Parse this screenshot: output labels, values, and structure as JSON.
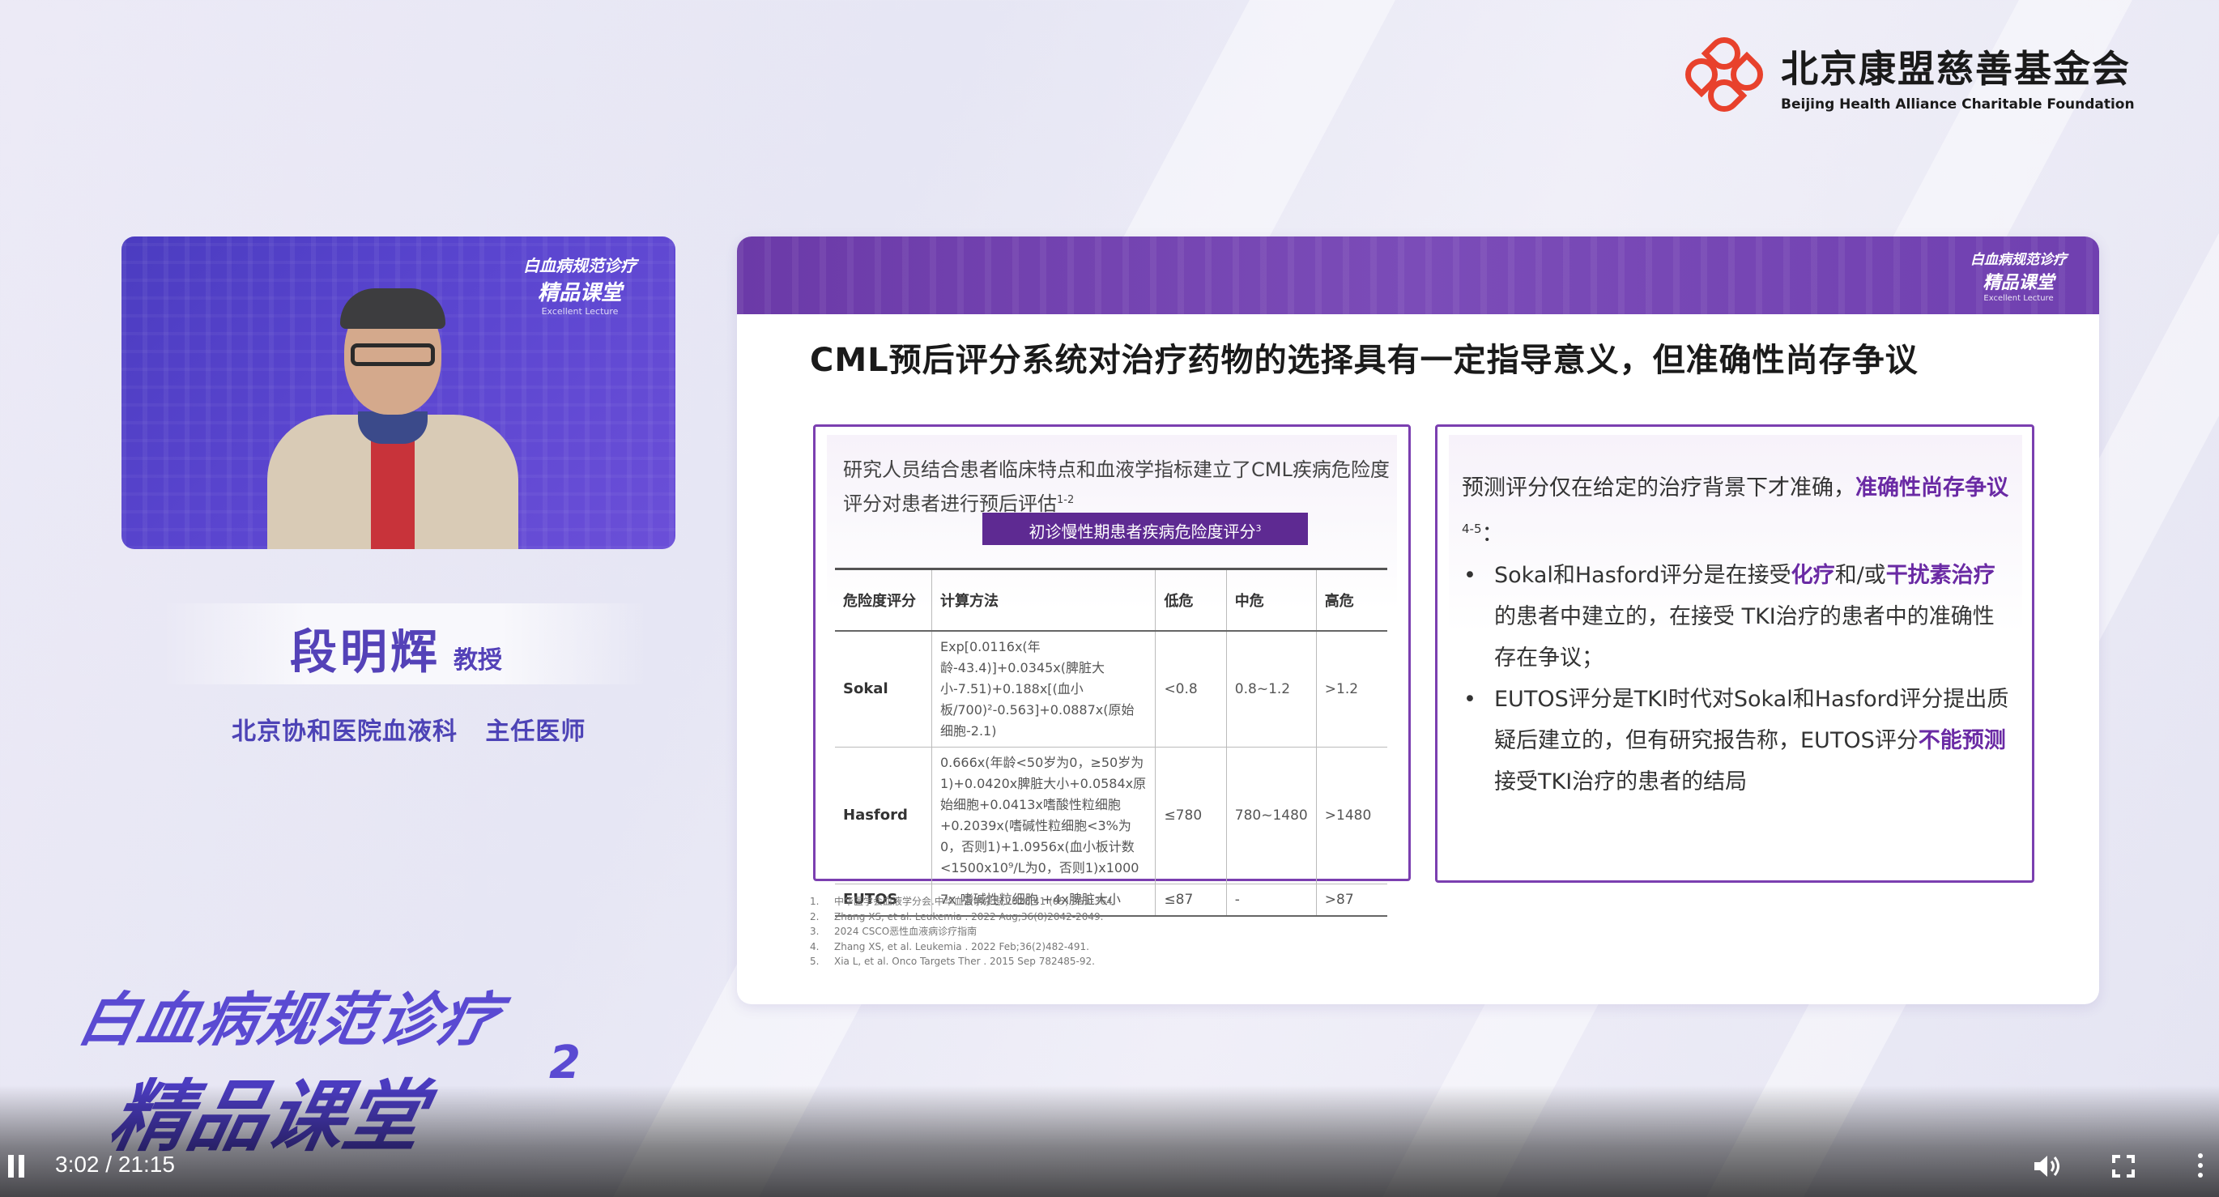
{
  "foundation": {
    "name_cn": "北京康盟慈善基金会",
    "name_en": "Beijing Health Alliance Charitable Foundation"
  },
  "video": {
    "brand_line1": "白血病规范诊疗",
    "brand_line2": "精品课堂",
    "brand_line3": "Excellent Lecture"
  },
  "speaker": {
    "name": "段明辉",
    "title": "教授",
    "affiliation": "北京协和医院血液科   主任医师"
  },
  "bottom_brand": {
    "line1": "白血病规范诊疗",
    "line2": "精品课堂",
    "suffix": "2"
  },
  "slide": {
    "brand_line1": "白血病规范诊疗",
    "brand_line2": "精品课堂",
    "brand_line3": "Excellent Lecture",
    "title": "CML预后评分系统对治疗药物的选择具有一定指导意义，但准确性尚存争议",
    "left_intro": "研究人员结合患者临床特点和血液学指标建立了CML疾病危险度评分对患者进行预后评估",
    "left_intro_sup": "1-2",
    "table_title": "初诊慢性期患者疾病危险度评分",
    "table_title_sup": "3",
    "table_headers": [
      "危险度评分",
      "计算方法",
      "低危",
      "中危",
      "高危"
    ],
    "table_rows": [
      {
        "score": "Sokal",
        "method": "Exp[0.0116x(年龄-43.4)]+0.0345x(脾脏大小-7.51)+0.188x[(血小板/700)²-0.563]+0.0887x(原始细胞-2.1)",
        "low": "<0.8",
        "mid": "0.8~1.2",
        "high": ">1.2"
      },
      {
        "score": "Hasford",
        "method": "0.666x(年龄<50岁为0，≥50岁为1)+0.0420x脾脏大小+0.0584x原始细胞+0.0413x嗜酸性粒细胞+0.2039x(嗜碱性粒细胞<3%为0，否则1)+1.0956x(血小板计数<1500x10⁹/L为0，否则1)x1000",
        "low": "≤780",
        "mid": "780~1480",
        "high": ">1480"
      },
      {
        "score": "EUTOS",
        "method": "7x 嗜碱性粒细胞 +4x脾脏大小",
        "low": "≤87",
        "mid": "-",
        "high": ">87"
      }
    ],
    "right_intro": "预测评分仅在给定的治疗背景下才准确，",
    "right_intro_hl": "准确性尚存争议",
    "right_intro_sup": "4-5",
    "right_intro_end": "：",
    "bullet1_a": "Sokal和Hasford评分是在接受",
    "bullet1_hl1": "化疗",
    "bullet1_b": "和/或",
    "bullet1_hl2": "干扰素治疗",
    "bullet1_c": "的患者中建立的，在接受 TKI治疗的患者中的准确性存在争议；",
    "bullet2_a": "EUTOS评分是TKI时代对Sokal和Hasford评分提出质疑后建立的，但有研究报告称，EUTOS评分",
    "bullet2_hl": "不能预测",
    "bullet2_b": "接受TKI治疗的患者的结局",
    "references": [
      {
        "num": "1.",
        "text": "中华医学会血液学分会.中华血液学杂志,2020,41 (05) 353-364."
      },
      {
        "num": "2.",
        "text": "Zhang XS, et al. Leukemia . 2022 Aug;36(8)2042-2049."
      },
      {
        "num": "3.",
        "text": "2024 CSCO恶性血液病诊疗指南"
      },
      {
        "num": "4.",
        "text": "Zhang XS, et al. Leukemia . 2022 Feb;36(2)482-491."
      },
      {
        "num": "5.",
        "text": "Xia L, et al. Onco Targets Ther . 2015 Sep 782485-92."
      }
    ]
  },
  "player": {
    "time": "3:02 / 21:15",
    "progress_fraction": 0.1426
  }
}
